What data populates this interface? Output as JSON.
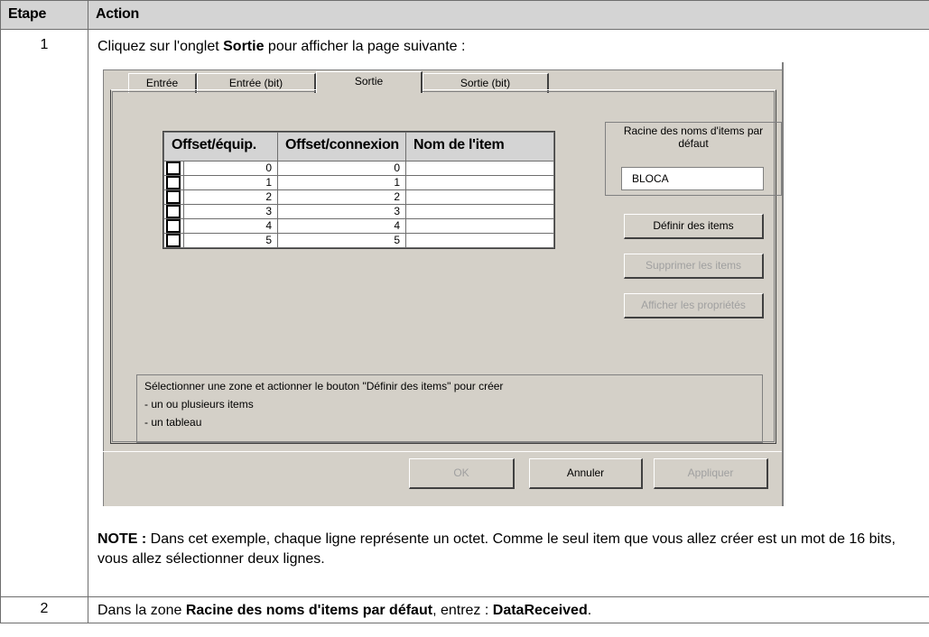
{
  "table": {
    "header_step": "Etape",
    "header_action": "Action"
  },
  "step1": {
    "number": "1",
    "instruction_pre": "Cliquez sur l'onglet ",
    "instruction_bold": "Sortie",
    "instruction_post": " pour afficher la page suivante :",
    "note_label": "NOTE :",
    "note_text": " Dans cet exemple, chaque ligne représente un octet. Comme le seul item que vous allez créer est un mot de 16 bits, vous allez sélectionner deux lignes."
  },
  "step2": {
    "number": "2",
    "text_pre": "Dans la zone ",
    "text_bold": "Racine des noms d'items par défaut",
    "text_mid": ", entrez : ",
    "text_bold2": "DataReceived",
    "text_post": "."
  },
  "dialog": {
    "tabs": [
      {
        "label": "Entrée",
        "active": false
      },
      {
        "label": "Entrée (bit)",
        "active": false
      },
      {
        "label": "Sortie",
        "active": true
      },
      {
        "label": "Sortie (bit)",
        "active": false
      }
    ],
    "grid": {
      "columns": [
        "Offset/équip.",
        "Offset/connexion",
        "Nom de l'item"
      ],
      "rows": [
        {
          "offset_equip": "0",
          "offset_conn": "0",
          "name": ""
        },
        {
          "offset_equip": "1",
          "offset_conn": "1",
          "name": ""
        },
        {
          "offset_equip": "2",
          "offset_conn": "2",
          "name": ""
        },
        {
          "offset_equip": "3",
          "offset_conn": "3",
          "name": ""
        },
        {
          "offset_equip": "4",
          "offset_conn": "4",
          "name": ""
        },
        {
          "offset_equip": "5",
          "offset_conn": "5",
          "name": ""
        }
      ]
    },
    "root_group_label": "Racine des noms d'items par défaut",
    "root_value": "BLOCA",
    "buttons": {
      "define": "Définir des items",
      "delete": "Supprimer les items",
      "props": "Afficher les propriétés"
    },
    "hint_lines": [
      "Sélectionner une zone et actionner le bouton \"Définir des items\" pour créer",
      "- un ou plusieurs items",
      "- un tableau"
    ],
    "footer_buttons": {
      "ok": "OK",
      "cancel": "Annuler",
      "apply": "Appliquer"
    }
  }
}
